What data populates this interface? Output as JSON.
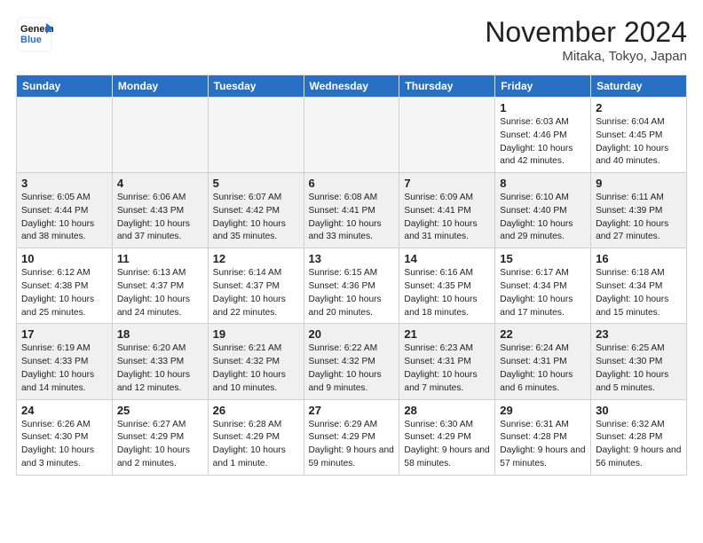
{
  "logo": {
    "general": "General",
    "blue": "Blue"
  },
  "header": {
    "month": "November 2024",
    "location": "Mitaka, Tokyo, Japan"
  },
  "weekdays": [
    "Sunday",
    "Monday",
    "Tuesday",
    "Wednesday",
    "Thursday",
    "Friday",
    "Saturday"
  ],
  "weeks": [
    [
      {
        "day": "",
        "empty": true
      },
      {
        "day": "",
        "empty": true
      },
      {
        "day": "",
        "empty": true
      },
      {
        "day": "",
        "empty": true
      },
      {
        "day": "",
        "empty": true
      },
      {
        "day": "1",
        "sunrise": "6:03 AM",
        "sunset": "4:46 PM",
        "daylight": "10 hours and 42 minutes."
      },
      {
        "day": "2",
        "sunrise": "6:04 AM",
        "sunset": "4:45 PM",
        "daylight": "10 hours and 40 minutes."
      }
    ],
    [
      {
        "day": "3",
        "sunrise": "6:05 AM",
        "sunset": "4:44 PM",
        "daylight": "10 hours and 38 minutes."
      },
      {
        "day": "4",
        "sunrise": "6:06 AM",
        "sunset": "4:43 PM",
        "daylight": "10 hours and 37 minutes."
      },
      {
        "day": "5",
        "sunrise": "6:07 AM",
        "sunset": "4:42 PM",
        "daylight": "10 hours and 35 minutes."
      },
      {
        "day": "6",
        "sunrise": "6:08 AM",
        "sunset": "4:41 PM",
        "daylight": "10 hours and 33 minutes."
      },
      {
        "day": "7",
        "sunrise": "6:09 AM",
        "sunset": "4:41 PM",
        "daylight": "10 hours and 31 minutes."
      },
      {
        "day": "8",
        "sunrise": "6:10 AM",
        "sunset": "4:40 PM",
        "daylight": "10 hours and 29 minutes."
      },
      {
        "day": "9",
        "sunrise": "6:11 AM",
        "sunset": "4:39 PM",
        "daylight": "10 hours and 27 minutes."
      }
    ],
    [
      {
        "day": "10",
        "sunrise": "6:12 AM",
        "sunset": "4:38 PM",
        "daylight": "10 hours and 25 minutes."
      },
      {
        "day": "11",
        "sunrise": "6:13 AM",
        "sunset": "4:37 PM",
        "daylight": "10 hours and 24 minutes."
      },
      {
        "day": "12",
        "sunrise": "6:14 AM",
        "sunset": "4:37 PM",
        "daylight": "10 hours and 22 minutes."
      },
      {
        "day": "13",
        "sunrise": "6:15 AM",
        "sunset": "4:36 PM",
        "daylight": "10 hours and 20 minutes."
      },
      {
        "day": "14",
        "sunrise": "6:16 AM",
        "sunset": "4:35 PM",
        "daylight": "10 hours and 18 minutes."
      },
      {
        "day": "15",
        "sunrise": "6:17 AM",
        "sunset": "4:34 PM",
        "daylight": "10 hours and 17 minutes."
      },
      {
        "day": "16",
        "sunrise": "6:18 AM",
        "sunset": "4:34 PM",
        "daylight": "10 hours and 15 minutes."
      }
    ],
    [
      {
        "day": "17",
        "sunrise": "6:19 AM",
        "sunset": "4:33 PM",
        "daylight": "10 hours and 14 minutes."
      },
      {
        "day": "18",
        "sunrise": "6:20 AM",
        "sunset": "4:33 PM",
        "daylight": "10 hours and 12 minutes."
      },
      {
        "day": "19",
        "sunrise": "6:21 AM",
        "sunset": "4:32 PM",
        "daylight": "10 hours and 10 minutes."
      },
      {
        "day": "20",
        "sunrise": "6:22 AM",
        "sunset": "4:32 PM",
        "daylight": "10 hours and 9 minutes."
      },
      {
        "day": "21",
        "sunrise": "6:23 AM",
        "sunset": "4:31 PM",
        "daylight": "10 hours and 7 minutes."
      },
      {
        "day": "22",
        "sunrise": "6:24 AM",
        "sunset": "4:31 PM",
        "daylight": "10 hours and 6 minutes."
      },
      {
        "day": "23",
        "sunrise": "6:25 AM",
        "sunset": "4:30 PM",
        "daylight": "10 hours and 5 minutes."
      }
    ],
    [
      {
        "day": "24",
        "sunrise": "6:26 AM",
        "sunset": "4:30 PM",
        "daylight": "10 hours and 3 minutes."
      },
      {
        "day": "25",
        "sunrise": "6:27 AM",
        "sunset": "4:29 PM",
        "daylight": "10 hours and 2 minutes."
      },
      {
        "day": "26",
        "sunrise": "6:28 AM",
        "sunset": "4:29 PM",
        "daylight": "10 hours and 1 minute."
      },
      {
        "day": "27",
        "sunrise": "6:29 AM",
        "sunset": "4:29 PM",
        "daylight": "9 hours and 59 minutes."
      },
      {
        "day": "28",
        "sunrise": "6:30 AM",
        "sunset": "4:29 PM",
        "daylight": "9 hours and 58 minutes."
      },
      {
        "day": "29",
        "sunrise": "6:31 AM",
        "sunset": "4:28 PM",
        "daylight": "9 hours and 57 minutes."
      },
      {
        "day": "30",
        "sunrise": "6:32 AM",
        "sunset": "4:28 PM",
        "daylight": "9 hours and 56 minutes."
      }
    ]
  ],
  "labels": {
    "sunrise": "Sunrise:",
    "sunset": "Sunset:",
    "daylight": "Daylight:"
  }
}
